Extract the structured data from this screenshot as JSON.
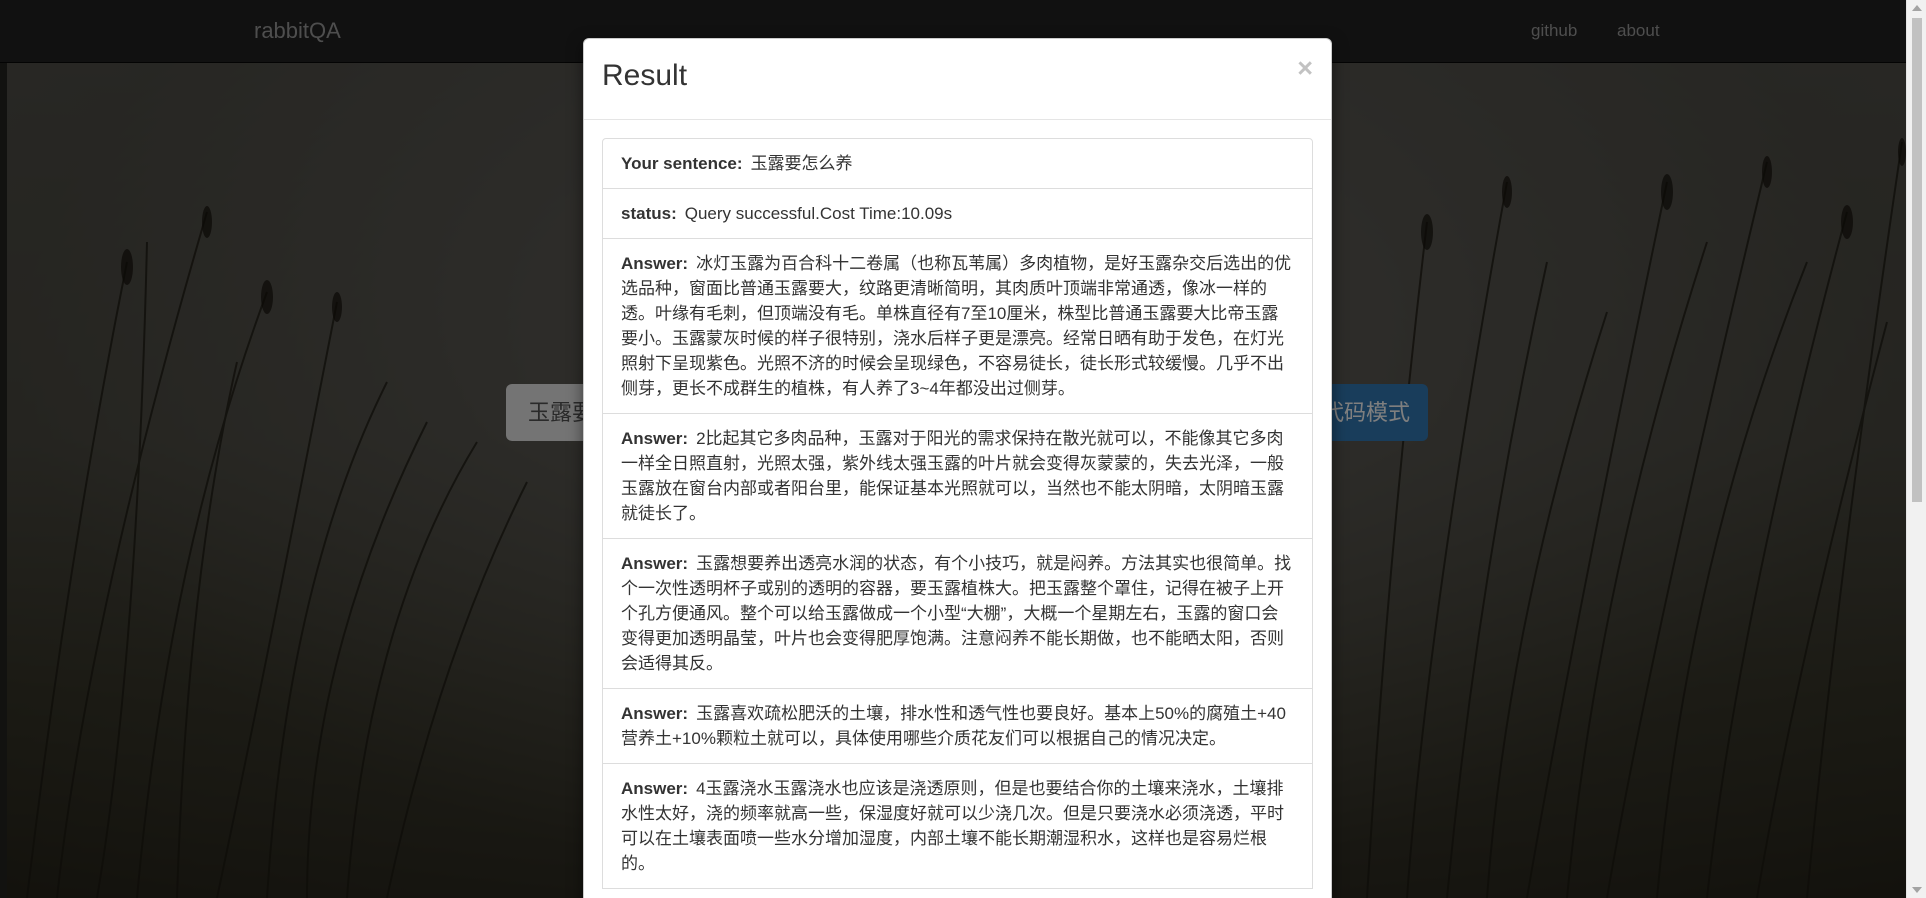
{
  "navbar": {
    "brand": "rabbitQA",
    "links": [
      "github",
      "about"
    ]
  },
  "search": {
    "value": "玉露要怎么养",
    "mode_button": "代码模式"
  },
  "modal": {
    "title": "Result",
    "close_icon": "×",
    "sentence_label": "Your sentence:",
    "sentence_value": "玉露要怎么养",
    "status_label": "status:",
    "status_value": "Query successful.Cost Time:10.09s",
    "answer_label": "Answer:",
    "answers": [
      "冰灯玉露为百合科十二卷属（也称瓦苇属）多肉植物，是好玉露杂交后选出的优选品种，窗面比普通玉露要大，纹路更清晰简明，其肉质叶顶端非常通透，像冰一样的透。叶缘有毛刺，但顶端没有毛。单株直径有7至10厘米，株型比普通玉露要大比帝玉露要小。玉露蒙灰时候的样子很特别，浇水后样子更是漂亮。经常日晒有助于发色，在灯光照射下呈现紫色。光照不济的时候会呈现绿色，不容易徒长，徒长形式较缓慢。几乎不出侧芽，更长不成群生的植株，有人养了3~4年都没出过侧芽。",
      "2比起其它多肉品种，玉露对于阳光的需求保持在散光就可以，不能像其它多肉一样全日照直射，光照太强，紫外线太强玉露的叶片就会变得灰蒙蒙的，失去光泽，一般玉露放在窗台内部或者阳台里，能保证基本光照就可以，当然也不能太阴暗，太阴暗玉露就徒长了。",
      "玉露想要养出透亮水润的状态，有个小技巧，就是闷养。方法其实也很简单。找个一次性透明杯子或别的透明的容器，要玉露植株大。把玉露整个罩住，记得在被子上开个孔方便通风。整个可以给玉露做成一个小型“大棚”，大概一个星期左右，玉露的窗口会变得更加透明晶莹，叶片也会变得肥厚饱满。注意闷养不能长期做，也不能晒太阳，否则会适得其反。",
      "玉露喜欢疏松肥沃的土壤，排水性和透气性也要良好。基本上50%的腐殖土+40营养土+10%颗粒土就可以，具体使用哪些介质花友们可以根据自己的情况决定。",
      "4玉露浇水玉露浇水也应该是浇透原则，但是也要结合你的土壤来浇水，土壤排水性太好，浇的频率就高一些，保湿度好就可以少浇几次。但是只要浇水必须浇透，平时可以在土壤表面喷一些水分增加湿度，内部土壤不能长期潮湿积水，这样也是容易烂根的。"
    ]
  },
  "colors": {
    "navbar_bg": "#222222",
    "nav_text": "#9d9d9d",
    "primary_button": "#337ab7"
  }
}
